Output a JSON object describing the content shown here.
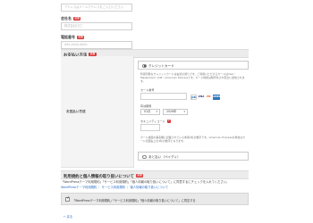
{
  "top_field": {
    "placeholder": "アドレスはメールアドレスをご入力ください"
  },
  "company": {
    "label": "会社名",
    "required": "必須",
    "placeholder": "株式会社〇〇"
  },
  "phone": {
    "label": "電話番号",
    "required": "必須",
    "placeholder": "090-0000-0000"
  },
  "payment_section": {
    "title": "お支払い方法",
    "required": "必須"
  },
  "payment": {
    "label": "お支払い方法",
    "credit_option": "クレジットカード",
    "credit_note": "利用可能なクレジットカードは右記の通りです。ご利用いただけるカードはVisa・MasterCard・JCB・American Expressです。カード情報は暗号化され安全に送信されます。",
    "card_number_label": "カード番号",
    "card_number_placeholder": "",
    "card_brands": [
      "JCB",
      "VISA",
      "MC",
      "AMEX"
    ],
    "expiry_label": "有効期限",
    "expiry_month": "01月",
    "expiry_year": "2026年",
    "cvc_label": "セキュリティコード",
    "cvc_placeholder": "",
    "cvc_note": "カード裏面の署名欄に記載されている末尾3桁の数字です。American Expressの場合はカード表面右上の4桁の数字となります。",
    "bank_option": "あと払い（ペイディ）"
  },
  "terms_section": {
    "title": "利用規約と個人情報の取り扱いについて",
    "required": "必須"
  },
  "terms": {
    "line1": "「WordPressテーマ利用規約」「サービス利用規約」「個人情報の取り扱いについて」に同意するにチェックを入れてください。",
    "link1": "WordPressテーマ利用規約",
    "link2": "サービス利用規約",
    "link3": "個人情報の取り扱いについて",
    "agree_text": "「WordPressテーマ利用規約」「サービス利用規約」「個人情報の取り扱いについて」に同意する"
  },
  "back_link": "← 戻る"
}
